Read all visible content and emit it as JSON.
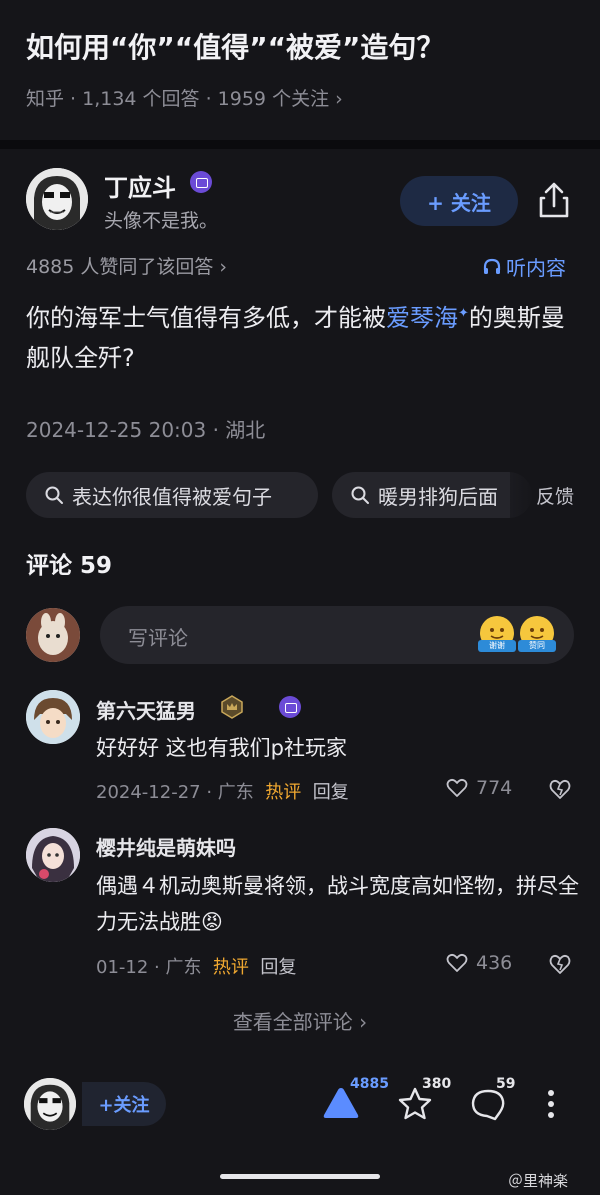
{
  "question": {
    "title": "如何用“你”“值得”“被爱”造句？",
    "meta": "知乎 · 1,134 个回答 · 1959 个关注 ›"
  },
  "author": {
    "name": "丁应斗",
    "bio": "头像不是我。",
    "follow_label": "+ 关注"
  },
  "answer": {
    "likes_line": "4885 人赞同了该回答 ›",
    "listen_label": "听内容",
    "text_before": "你的海军士气值得有多低，才能被",
    "text_highlight": "爱琴海",
    "text_after": "的奥斯曼舰队全歼?",
    "datetime": "2024-12-25 20:03 · 湖北"
  },
  "search_chips": [
    "表达你很值得被爱句子",
    "暖男排狗后面"
  ],
  "feedback_label": "反馈",
  "comments": {
    "title": "评论 59",
    "input_placeholder": "写评论",
    "emoji_labels": [
      "谢谢",
      "赞同"
    ],
    "items": [
      {
        "name": "第六天猛男",
        "text": "好好好 这也有我们p社玩家",
        "date": "2024-12-27 · 广东",
        "hot": "热评",
        "reply": "回复",
        "likes": "774"
      },
      {
        "name": "樱井纯是萌妹吗",
        "text": "偶遇４机动奥斯曼将领，战斗宽度高如怪物，拼尽全力无法战胜😡",
        "date": "01-12 · 广东",
        "hot": "热评",
        "reply": "回复",
        "likes": "436"
      }
    ],
    "view_all": "查看全部评论 ›"
  },
  "bottom_bar": {
    "follow_label": "+关注",
    "upvotes": "4885",
    "favorites": "380",
    "comments": "59"
  },
  "watermark": "＠里神楽",
  "colors": {
    "background": "#151519",
    "accent_blue": "#6a9cff",
    "hot_orange": "#f0a830"
  }
}
